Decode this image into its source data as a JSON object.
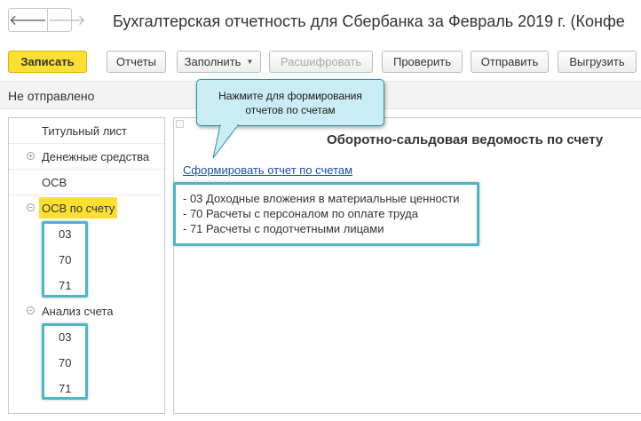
{
  "window": {
    "title": "Бухгалтерская отчетность для Сбербанка за Февраль 2019 г. (Конфе",
    "nav": {
      "back_icon": "arrow-left-icon",
      "forward_icon": "arrow-right-icon"
    }
  },
  "toolbar": {
    "save": "Записать",
    "reports": "Отчеты",
    "fill": "Заполнить",
    "decode": "Расшифровать",
    "check": "Проверить",
    "send": "Отправить",
    "export": "Выгрузить"
  },
  "status": {
    "text": "Не отправлено"
  },
  "tree": {
    "title_page": "Титульный лист",
    "cash": "Денежные средства",
    "osv": "ОСВ",
    "osv_by_account": "ОСВ по счету",
    "osv_accounts": [
      "03",
      "70",
      "71"
    ],
    "account_analysis": "Анализ счета",
    "analysis_accounts": [
      "03",
      "70",
      "71"
    ],
    "expand_symbol": "+",
    "collapse_symbol": "−"
  },
  "content": {
    "report_title": "Оборотно-сальдовая ведомость по счету",
    "link": "Сформировать отчет по счетам",
    "accounts": [
      "- 03 Доходные вложения в материальные ценности",
      "- 70 Расчеты с персоналом по оплате труда",
      "- 71 Расчеты с подотчетными лицами"
    ]
  },
  "tooltip": {
    "line1": "Нажмите для формирования",
    "line2": "отчетов по счетам"
  },
  "colors": {
    "accent_yellow": "#fbe032",
    "highlight_teal": "#4fb5c5",
    "tooltip_bg": "#c9ecf5",
    "link_blue": "#1a4fa0"
  }
}
